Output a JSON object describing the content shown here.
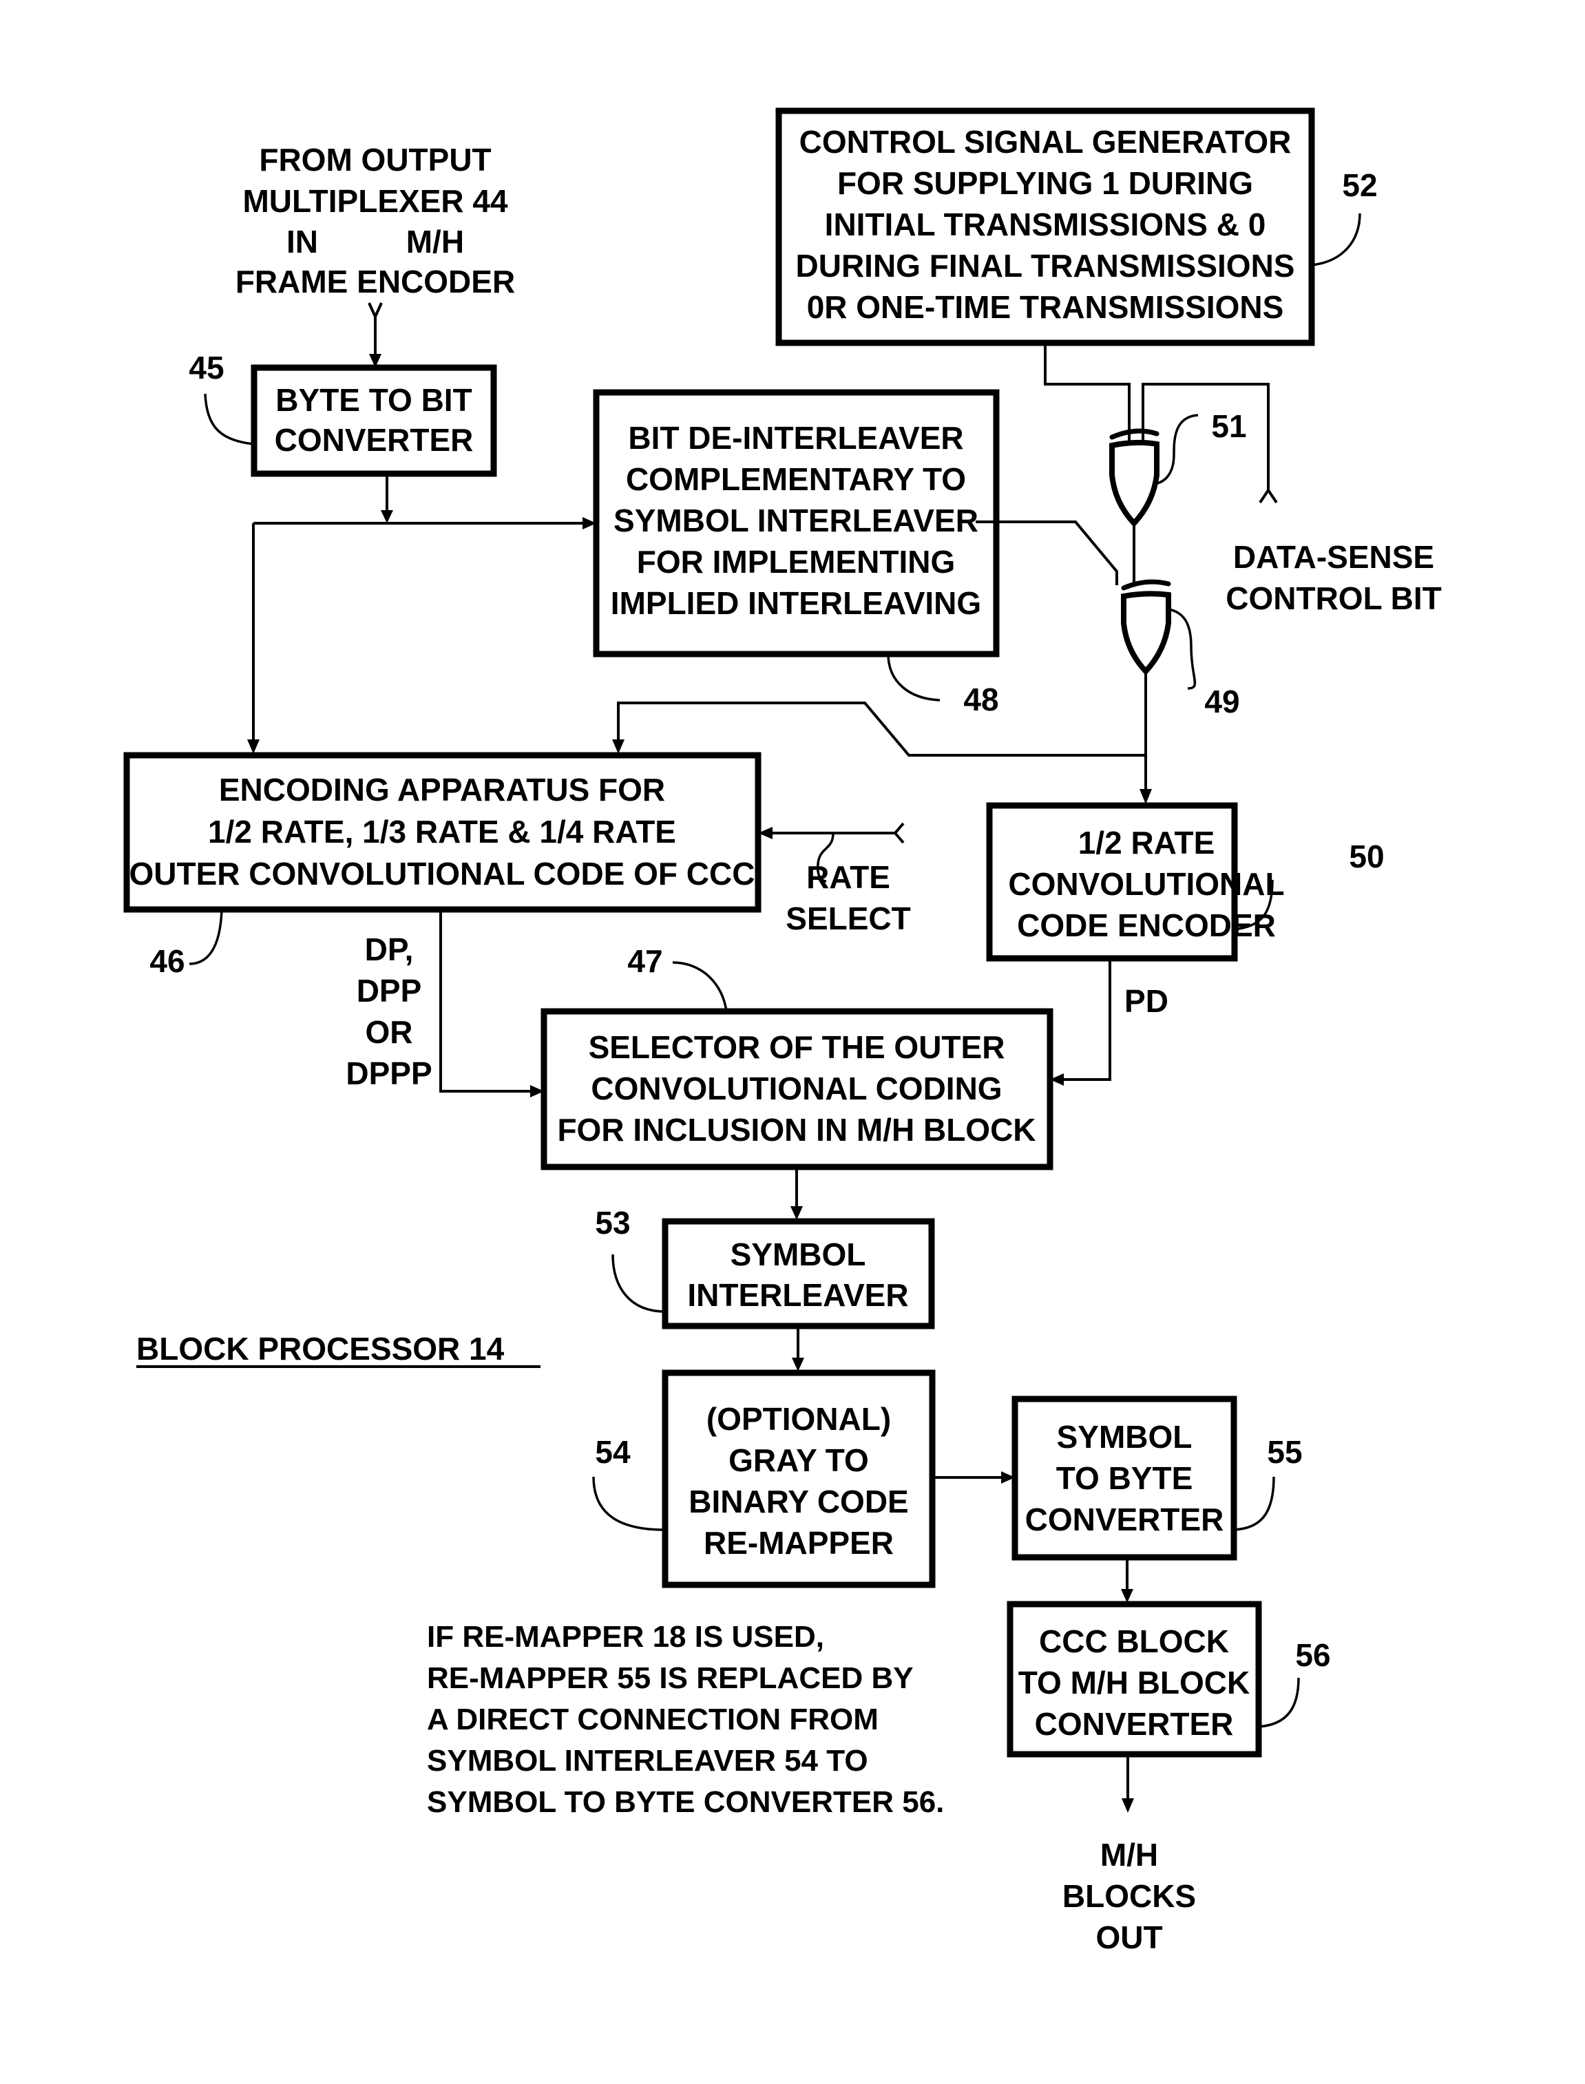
{
  "figure": {
    "title": "BLOCK PROCESSOR 14",
    "input_label": [
      "FROM OUTPUT",
      "MULTIPLEXER 44",
      "IN          M/H",
      "FRAME ENCODER"
    ],
    "output_label": [
      "M/H",
      "BLOCKS",
      "OUT"
    ],
    "note": [
      "IF RE-MAPPER 18 IS USED,",
      "RE-MAPPER 55 IS REPLACED BY",
      "A DIRECT CONNECTION FROM",
      "SYMBOL INTERLEAVER 54 TO",
      "SYMBOL TO BYTE CONVERTER 56."
    ]
  },
  "blocks": {
    "byte_to_bit": {
      "ref": "45",
      "lines": [
        "BYTE TO BIT",
        "CONVERTER"
      ]
    },
    "control_signal": {
      "ref": "52",
      "lines": [
        "CONTROL SIGNAL GENERATOR",
        "FOR SUPPLYING 1 DURING",
        "INITIAL TRANSMISSIONS & 0",
        "DURING FINAL TRANSMISSIONS",
        "0R ONE-TIME TRANSMISSIONS"
      ]
    },
    "bit_deinterleaver": {
      "ref": "48",
      "lines": [
        "BIT DE-INTERLEAVER",
        "COMPLEMENTARY TO",
        "SYMBOL INTERLEAVER",
        "FOR IMPLEMENTING",
        "IMPLIED INTERLEAVING"
      ]
    },
    "encoding_apparatus": {
      "ref": "46",
      "lines": [
        "ENCODING APPARATUS FOR",
        "1/2 RATE, 1/3 RATE & 1/4 RATE",
        "OUTER CONVOLUTIONAL CODE OF CCC"
      ]
    },
    "half_rate_encoder": {
      "ref": "50",
      "lines": [
        "1/2 RATE",
        "CONVOLUTIONAL",
        "CODE ENCODER"
      ]
    },
    "selector": {
      "ref": "47",
      "lines": [
        "SELECTOR OF THE OUTER",
        "CONVOLUTIONAL CODING",
        "FOR INCLUSION IN M/H BLOCK"
      ]
    },
    "symbol_interleaver": {
      "ref": "53",
      "lines": [
        "SYMBOL",
        "INTERLEAVER"
      ]
    },
    "gray_remapper": {
      "ref": "54",
      "lines": [
        "(OPTIONAL)",
        "GRAY TO",
        "BINARY CODE",
        "RE-MAPPER"
      ]
    },
    "symbol_to_byte": {
      "ref": "55",
      "lines": [
        "SYMBOL",
        "TO BYTE",
        "CONVERTER"
      ]
    },
    "ccc_to_mh": {
      "ref": "56",
      "lines": [
        "CCC BLOCK",
        "TO M/H BLOCK",
        "CONVERTER"
      ]
    }
  },
  "gates": {
    "xor_51": {
      "ref": "51",
      "type": "XOR"
    },
    "xor_49": {
      "ref": "49",
      "type": "XOR"
    }
  },
  "signals": {
    "data_sense": [
      "DATA-SENSE",
      "CONTROL BIT"
    ],
    "rate_select": [
      "RATE",
      "SELECT"
    ],
    "encoder_out": [
      "DP,",
      "DPP",
      "OR",
      "DPPP"
    ],
    "pd": "PD"
  }
}
